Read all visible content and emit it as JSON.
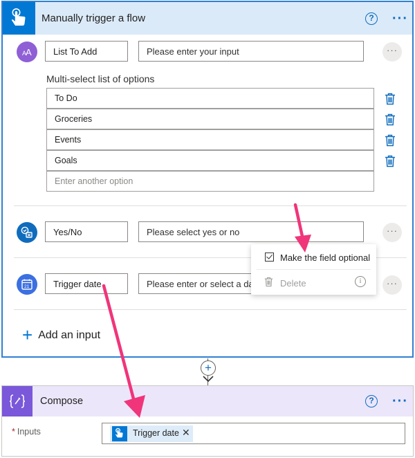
{
  "trigger": {
    "title": "Manually trigger a flow",
    "help_icon": "question-circle-icon",
    "more_icon": "ellipsis-icon",
    "help_glyph": "?",
    "more_glyph": "···"
  },
  "inputs": [
    {
      "icon": "text-icon",
      "name": "List To Add",
      "placeholder": "Please enter your input"
    },
    {
      "icon": "yes-no-icon",
      "name": "Yes/No",
      "placeholder": "Please select yes or no"
    },
    {
      "icon": "calendar-icon",
      "name": "Trigger date",
      "placeholder": "Please enter or select a date"
    }
  ],
  "multiselect": {
    "label": "Multi-select list of options",
    "options": [
      "To Do",
      "Groceries",
      "Events",
      "Goals"
    ],
    "new_option_placeholder": "Enter another option"
  },
  "row_more_glyph": "···",
  "context_menu": {
    "optional_label": "Make the field optional",
    "delete_label": "Delete",
    "info_glyph": "i"
  },
  "add_input_label": "Add an input",
  "add_input_glyph": "+",
  "connector": {
    "plus_glyph": "+"
  },
  "compose": {
    "title": "Compose",
    "inputs_label": "Inputs",
    "required_mark": "*",
    "token_label": "Trigger date",
    "token_remove": "✕",
    "help_glyph": "?",
    "more_glyph": "···"
  },
  "colors": {
    "trigger_accent": "#0078d4",
    "trigger_header": "#dbeaf9",
    "compose_accent": "#7a58d9",
    "compose_header": "#ece6fb",
    "annotation_arrow": "#f0357a"
  }
}
